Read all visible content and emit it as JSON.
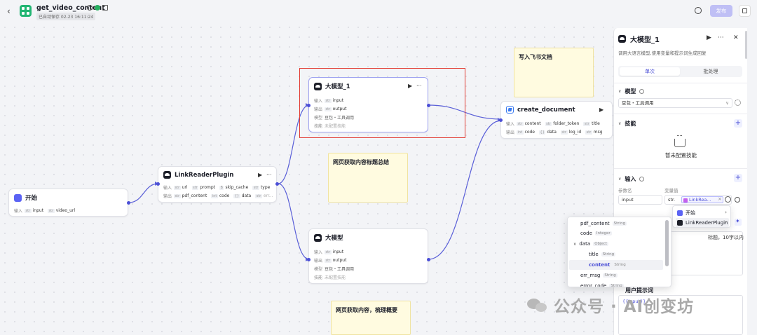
{
  "header": {
    "title": "get_video_content",
    "autosave": "已自动保存 02-23 16:11:24",
    "publish_label": "发布"
  },
  "nodes": {
    "start": {
      "title": "开始",
      "input_label": "输入",
      "params": [
        {
          "type": "str",
          "name": "input"
        },
        {
          "type": "str",
          "name": "video_url"
        }
      ]
    },
    "link_reader": {
      "title": "LinkReaderPlugin",
      "input_label": "输入",
      "output_label": "输出",
      "inputs": [
        {
          "type": "str",
          "name": "url"
        },
        {
          "type": "str",
          "name": "prompt"
        },
        {
          "type": "B",
          "name": "skip_cache"
        },
        {
          "type": "str",
          "name": "type"
        }
      ],
      "outputs": [
        {
          "type": "str",
          "name": "pdf_content"
        },
        {
          "type": "int",
          "name": "code"
        },
        {
          "type": "{}",
          "name": "data"
        },
        {
          "type": "str",
          "name": "err..."
        }
      ]
    },
    "llm1": {
      "title": "大模型_1",
      "input_label": "输入",
      "input_value": "input",
      "input_type": "str",
      "output_label": "输出",
      "output_value": "output",
      "output_type": "str",
      "model_label": "模型",
      "model_value": "豆包・工具调用",
      "skill_label": "技能",
      "skill_value": "未配置技能"
    },
    "llm2": {
      "title": "大模型",
      "input_label": "输入",
      "input_value": "input",
      "input_type": "str",
      "output_label": "输出",
      "output_value": "output",
      "output_type": "str",
      "model_label": "模型",
      "model_value": "豆包・工具调用",
      "skill_label": "技能",
      "skill_value": "未配置技能"
    },
    "create_doc": {
      "title": "create_document",
      "input_label": "输入",
      "output_label": "输出",
      "inputs": [
        {
          "type": "str",
          "name": "content"
        },
        {
          "type": "str",
          "name": "folder_token"
        },
        {
          "type": "str",
          "name": "title"
        }
      ],
      "outputs": [
        {
          "type": "int",
          "name": "code"
        },
        {
          "type": "{}",
          "name": "data"
        },
        {
          "type": "str",
          "name": "log_id"
        },
        {
          "type": "str",
          "name": "msg"
        }
      ]
    }
  },
  "notes": {
    "feishu": "写入飞书文档",
    "summary_title": "网页获取内容标题总结",
    "summary_outline": "网页获取内容，梳理概要"
  },
  "panel": {
    "title": "大模型_1",
    "description": "调用大语言模型,使用变量和提示词生成回复",
    "tabs": {
      "single": "单次",
      "batch": "批处理"
    },
    "model": {
      "label": "模型",
      "value": "豆包・工具调用"
    },
    "skills": {
      "label": "技能",
      "empty": "暂未配置技能"
    },
    "input": {
      "label": "输入",
      "col_name": "参数名",
      "col_value": "变量值",
      "param_name": "input",
      "type_abbr": "str.",
      "ref_value": "LinkRea..."
    },
    "system_prompt_partial": "标题，10字以内",
    "user_prompt": {
      "label": "用户提示词",
      "ref": "{{input}}"
    }
  },
  "node_picker": {
    "items": [
      {
        "label": "开始"
      },
      {
        "label": "LinkReaderPlugin"
      }
    ]
  },
  "field_picker": {
    "fields": [
      {
        "name": "pdf_content",
        "type": "String",
        "indent": 0
      },
      {
        "name": "code",
        "type": "Integer",
        "indent": 0
      },
      {
        "name": "data",
        "type": "Object",
        "indent": 0
      },
      {
        "name": "title",
        "type": "String",
        "indent": 1
      },
      {
        "name": "content",
        "type": "String",
        "indent": 1
      },
      {
        "name": "err_msg",
        "type": "String",
        "indent": 0
      },
      {
        "name": "error_code",
        "type": "String",
        "indent": 0
      }
    ]
  },
  "watermark": "公众号 · AI创变坊",
  "colors": {
    "accent": "#4b4fd6",
    "selection": "#e23b32",
    "note_bg": "#fffbe0",
    "publish_bg": "#bfbff5"
  }
}
